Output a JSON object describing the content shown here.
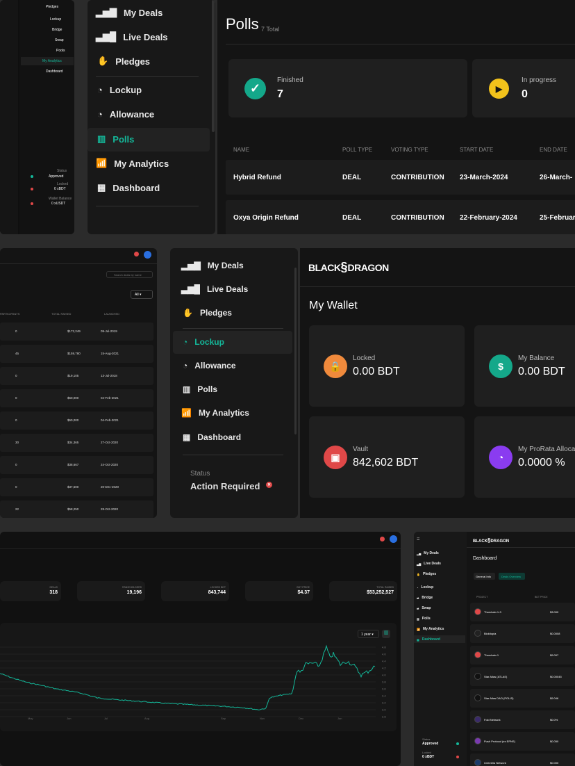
{
  "p1": {
    "items": [
      "Pledges",
      "Lockup",
      "Bridge",
      "Swap",
      "Pools",
      "My Analytics",
      "Dashboard"
    ],
    "status_label": "Status",
    "status_value": "Approved",
    "locked_label": "Locked",
    "locked_value": "0 xBDT",
    "wallet_label": "Wallet Balance",
    "wallet_value": "0 xUSDT"
  },
  "p2": {
    "nav": [
      "My Deals",
      "Live Deals",
      "Pledges",
      "Lockup",
      "Allowance",
      "Polls",
      "My Analytics",
      "Dashboard"
    ],
    "active": "Polls"
  },
  "p3": {
    "title": "Polls",
    "subtitle": "7 Total",
    "finished_label": "Finished",
    "finished_value": "7",
    "inprogress_label": "In progress",
    "inprogress_value": "0",
    "cols": [
      "NAME",
      "POLL TYPE",
      "VOTING TYPE",
      "START DATE",
      "END DATE"
    ],
    "rows": [
      [
        "Hybrid Refund",
        "DEAL",
        "CONTRIBUTION",
        "23-March-2024",
        "26-March-"
      ],
      [
        "Oxya Origin Refund",
        "DEAL",
        "CONTRIBUTION",
        "22-February-2024",
        "25-February"
      ]
    ]
  },
  "p4": {
    "search_placeholder": "Search deals by name",
    "filter": "All",
    "cols": [
      "PARTICIPANTS",
      "TOTAL RAISED",
      "LAUNCHED"
    ],
    "rows": [
      [
        "0",
        "$172,249",
        "09-Jul-2019"
      ],
      [
        "45",
        "$159,780",
        "15-Aug-2021"
      ],
      [
        "0",
        "$19,105",
        "13-Jul-2018"
      ],
      [
        "0",
        "$60,000",
        "04-Feb-2021"
      ],
      [
        "0",
        "$60,000",
        "04-Feb-2021"
      ],
      [
        "30",
        "$34,365",
        "27-Oct-2020"
      ],
      [
        "0",
        "$38,667",
        "24-Oct-2020"
      ],
      [
        "0",
        "$37,500",
        "20-Dec-2020"
      ],
      [
        "22",
        "$58,250",
        "28-Oct-2020"
      ]
    ]
  },
  "p5": {
    "nav": [
      "My Deals",
      "Live Deals",
      "Pledges",
      "Lockup",
      "Allowance",
      "Polls",
      "My Analytics",
      "Dashboard"
    ],
    "active": "Lockup",
    "status_label": "Status",
    "status_value": "Action Required"
  },
  "p6": {
    "logo_left": "BLACK",
    "logo_right": "DRAGON",
    "title": "My Wallet",
    "cards": [
      {
        "label": "Locked",
        "value": "0.00 BDT",
        "color": "#f08a3c",
        "icon": "lock-icon"
      },
      {
        "label": "My Balance",
        "value": "0.00 BDT",
        "color": "#14a88a",
        "icon": "money-hand-icon"
      },
      {
        "label": "Vault",
        "value": "842,602 BDT",
        "color": "#e04848",
        "icon": "vault-icon"
      },
      {
        "label": "My ProRata Allocation",
        "value": "0.0000 %",
        "color": "#8a3cf0",
        "icon": "pie-icon"
      }
    ]
  },
  "p7": {
    "stats": [
      {
        "label": "DEALS",
        "value": "318"
      },
      {
        "label": "STAKEHOLDERS",
        "value": "19,196"
      },
      {
        "label": "LOCKED BDT",
        "value": "843,744"
      },
      {
        "label": "BDT PRICE",
        "value": "$4.37"
      },
      {
        "label": "TOTAL RAISED",
        "value": "$53,252,527"
      }
    ],
    "range": "1 year",
    "y_ticks": [
      "4.8",
      "4.6",
      "4.4",
      "4.2",
      "4.0",
      "3.8",
      "3.6",
      "3.4",
      "3.2",
      "3.0",
      "2.8"
    ],
    "x_ticks": [
      "May",
      "Jun",
      "Jul",
      "Aug",
      "Sep",
      "Nov",
      "Dec",
      "Jan"
    ]
  },
  "p8": {
    "title": "Dashboard",
    "tabs": [
      "General Info",
      "Deals Overview"
    ],
    "nav": [
      "My Deals",
      "Live Deals",
      "Pledges",
      "Lockup",
      "Bridge",
      "Swap",
      "Polls",
      "My Analytics",
      "Dashboard"
    ],
    "cols": [
      "PROJECT",
      "BDT PRICE"
    ],
    "rows": [
      [
        "Thorchain 1-3",
        "$3.000"
      ],
      [
        "Blokitopia",
        "$0.0008"
      ],
      [
        "Thorchain 1",
        "$9.007"
      ],
      [
        "Star Atlas (ATLAS)",
        "$0.00045"
      ],
      [
        "Star Atlas DAO (POLIS)",
        "$9.046"
      ],
      [
        "Fold Network",
        "$0.0%"
      ],
      [
        "Push Protocol (ex EPNS)",
        "$0.050"
      ],
      [
        "Umbrella Network",
        "$0.000"
      ]
    ],
    "status_label": "Status",
    "status_value": "Approved",
    "locked_label": "Locked",
    "locked_value": "0 xBDT"
  },
  "colors": {
    "accent": "#14b89a",
    "bg": "#141414",
    "card": "#1f1f1f"
  }
}
